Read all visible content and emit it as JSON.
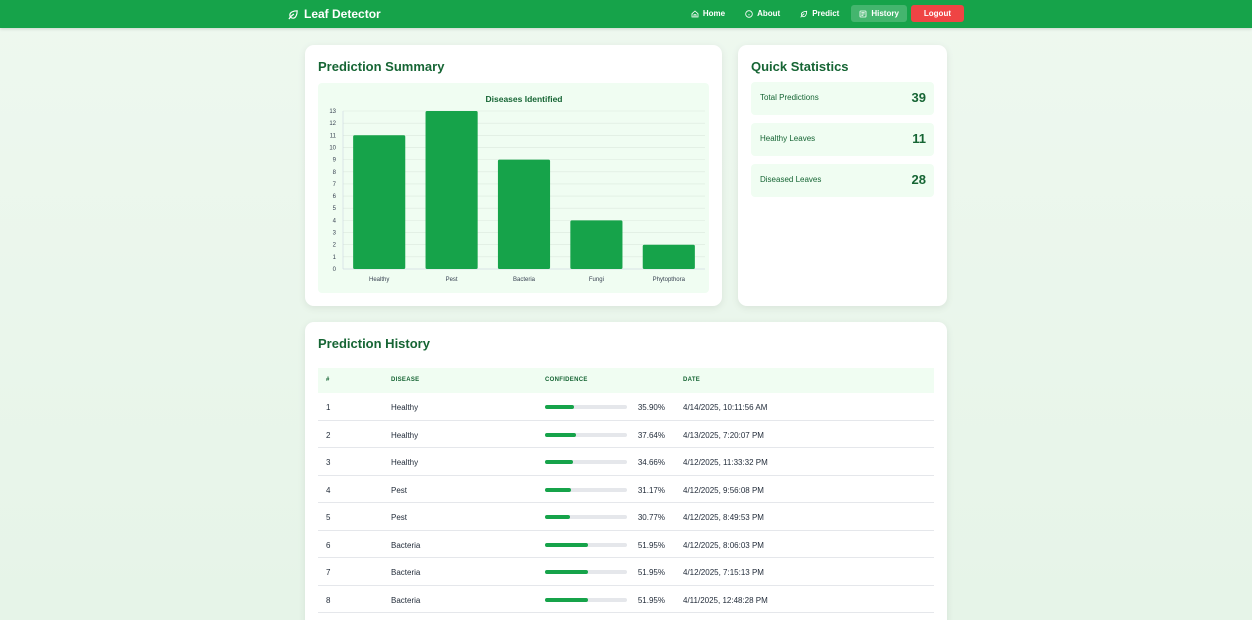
{
  "nav": {
    "brand": "Leaf Detector",
    "links": [
      {
        "label": "Home",
        "icon": "home-icon"
      },
      {
        "label": "About",
        "icon": "info-icon"
      },
      {
        "label": "Predict",
        "icon": "leaf-icon"
      },
      {
        "label": "History",
        "icon": "history-icon"
      }
    ],
    "logout": "Logout"
  },
  "colors": {
    "primary": "#16a34a",
    "logout": "#ef4444",
    "text_dark": "#166534"
  },
  "summary": {
    "title": "Prediction Summary"
  },
  "chart_data": {
    "type": "bar",
    "title": "Diseases Identified",
    "categories": [
      "Healthy",
      "Pest",
      "Bacteria",
      "Fungi",
      "Phytopthora"
    ],
    "values": [
      11,
      13,
      9,
      4,
      2
    ],
    "ylim": [
      0,
      13
    ],
    "yticks": [
      0,
      1,
      2,
      3,
      4,
      5,
      6,
      7,
      8,
      9,
      10,
      11,
      12,
      13
    ],
    "grid": true,
    "color": "#16a34a"
  },
  "stats": {
    "title": "Quick Statistics",
    "items": [
      {
        "label": "Total Predictions",
        "value": "39"
      },
      {
        "label": "Healthy Leaves",
        "value": "11"
      },
      {
        "label": "Diseased Leaves",
        "value": "28"
      }
    ]
  },
  "history": {
    "title": "Prediction History",
    "columns": [
      "#",
      "DISEASE",
      "CONFIDENCE",
      "DATE"
    ],
    "rows": [
      {
        "num": "1",
        "disease": "Healthy",
        "confidence": "35.90%",
        "conf_value": 35.9,
        "date": "4/14/2025, 10:11:56 AM"
      },
      {
        "num": "2",
        "disease": "Healthy",
        "confidence": "37.64%",
        "conf_value": 37.64,
        "date": "4/13/2025, 7:20:07 PM"
      },
      {
        "num": "3",
        "disease": "Healthy",
        "confidence": "34.66%",
        "conf_value": 34.66,
        "date": "4/12/2025, 11:33:32 PM"
      },
      {
        "num": "4",
        "disease": "Pest",
        "confidence": "31.17%",
        "conf_value": 31.17,
        "date": "4/12/2025, 9:56:08 PM"
      },
      {
        "num": "5",
        "disease": "Pest",
        "confidence": "30.77%",
        "conf_value": 30.77,
        "date": "4/12/2025, 8:49:53 PM"
      },
      {
        "num": "6",
        "disease": "Bacteria",
        "confidence": "51.95%",
        "conf_value": 51.95,
        "date": "4/12/2025, 8:06:03 PM"
      },
      {
        "num": "7",
        "disease": "Bacteria",
        "confidence": "51.95%",
        "conf_value": 51.95,
        "date": "4/12/2025, 7:15:13 PM"
      },
      {
        "num": "8",
        "disease": "Bacteria",
        "confidence": "51.95%",
        "conf_value": 51.95,
        "date": "4/11/2025, 12:48:28 PM"
      }
    ]
  }
}
